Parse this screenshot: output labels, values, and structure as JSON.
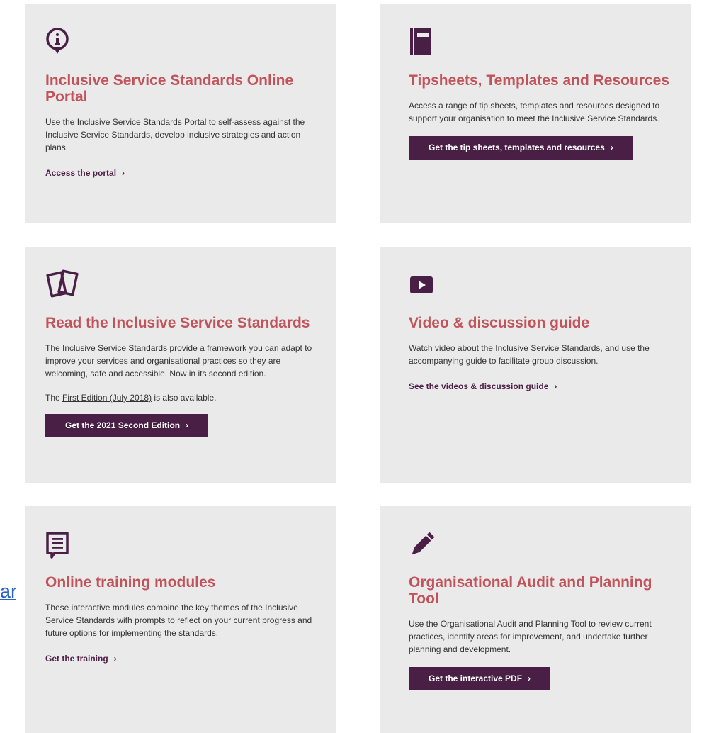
{
  "stray_link": "ar",
  "cards": [
    {
      "icon": "info-circle-icon",
      "title": "Inclusive Service Standards Online Portal",
      "description": "Use the Inclusive Service Standards Portal to self-assess against the Inclusive Service Standards, develop inclusive strategies and action plans.",
      "link_label": "Access the portal",
      "chevron": "›"
    },
    {
      "icon": "notebook-icon",
      "title": "Tipsheets, Templates and Resources",
      "description": "Access a range of tip sheets, templates and resources designed to support your organisation to meet the Inclusive Service Standards.",
      "button_label": "Get the tip sheets, templates and resources",
      "chevron": "›"
    },
    {
      "icon": "cards-icon",
      "title": "Read the Inclusive Service Standards",
      "description": "The Inclusive Service Standards provide a framework you can adapt to improve your services and organisational practices so they are welcoming, safe and accessible. Now in its second edition.",
      "note_prefix": "The ",
      "note_link": "First Edition (July 2018)",
      "note_suffix": " is also available.",
      "button_label": "Get the 2021 Second Edition",
      "chevron": "›"
    },
    {
      "icon": "video-play-icon",
      "title": "Video & discussion guide",
      "description": "Watch video about the Inclusive Service Standards, and use the accompanying guide to facilitate group discussion.",
      "link_label": "See the videos & discussion guide",
      "chevron": "›"
    },
    {
      "icon": "chat-bubble-icon",
      "title": "Online training modules",
      "description": "These interactive modules combine the key themes of the Inclusive Service Standards with prompts to reflect on your current progress and future options for implementing the standards.",
      "link_label": "Get the training",
      "chevron": "›"
    },
    {
      "icon": "pencil-icon",
      "title": "Organisational Audit and Planning Tool",
      "description": "Use the Organisational Audit and Planning Tool to review current practices, identify areas for improvement, and undertake further planning and development.",
      "button_label": "Get the interactive PDF",
      "chevron": "›"
    }
  ],
  "colors": {
    "card_bg": "#ebeaeb",
    "title": "#c0545a",
    "accent_purple": "#4a1f46",
    "stray_link": "#2a62c9"
  }
}
